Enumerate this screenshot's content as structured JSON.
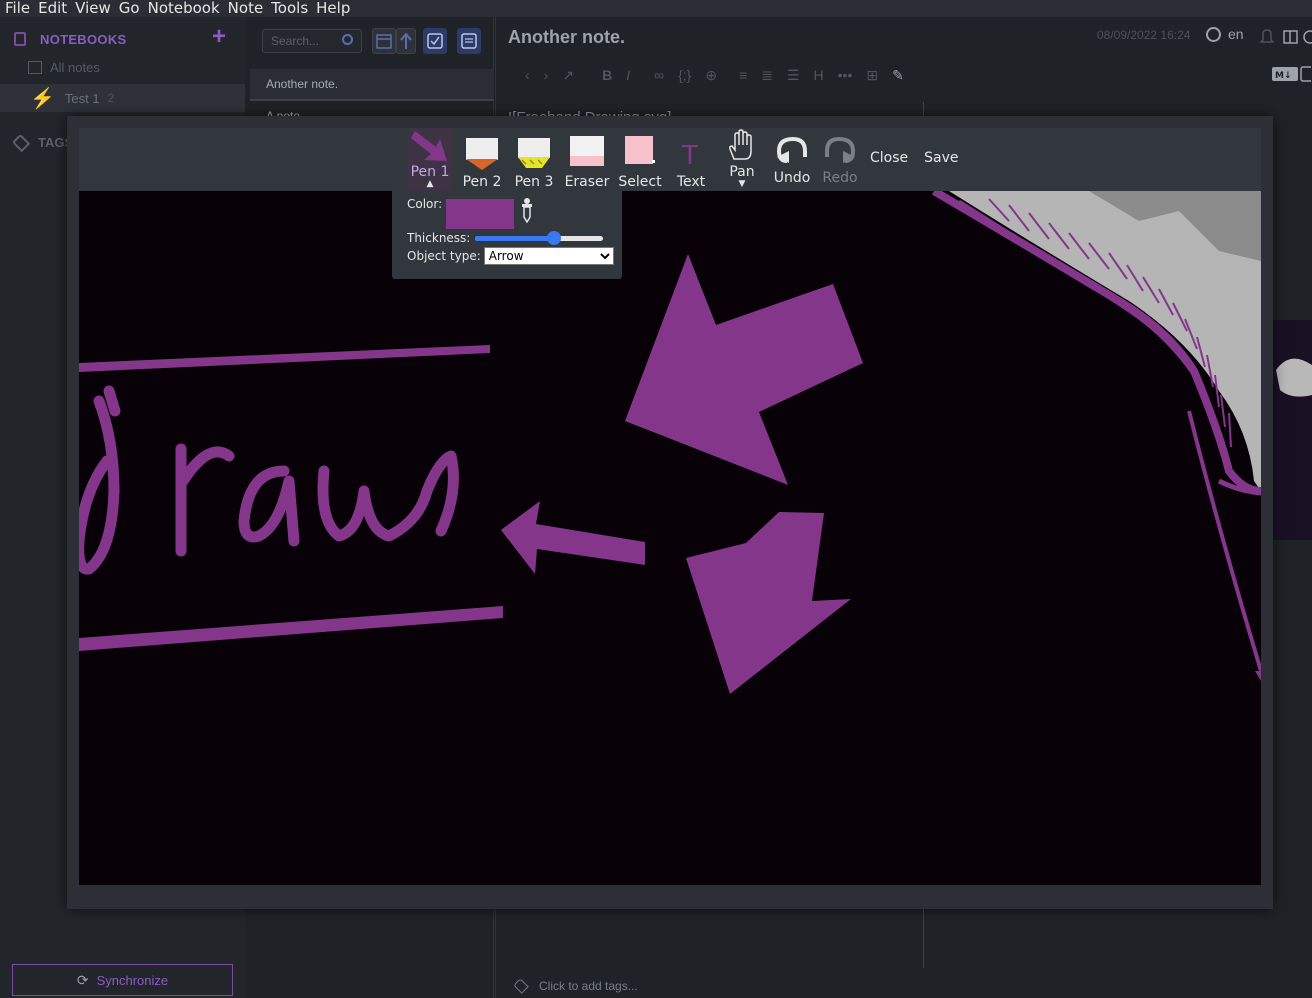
{
  "menu": [
    "File",
    "Edit",
    "View",
    "Go",
    "Notebook",
    "Note",
    "Tools",
    "Help"
  ],
  "sidebar": {
    "notebooks_label": "NOTEBOOKS",
    "all_notes": "All notes",
    "notebooks": [
      {
        "name": "Test 1",
        "count": "2"
      }
    ],
    "tags_label": "TAGS",
    "sync_label": "Synchronize"
  },
  "note_list": {
    "search_placeholder": "Search...",
    "notes": [
      "Another note.",
      "A note"
    ]
  },
  "editor": {
    "title": "Another note.",
    "date": "08/09/2022 16:24",
    "language": "en",
    "body_peek": "![Freehand Drawing.svg]",
    "add_tags": "Click to add tags..."
  },
  "drawing_dialog": {
    "tools": [
      {
        "label": "Pen 1",
        "icon": "arrow-pen-icon",
        "selected": true
      },
      {
        "label": "Pen 2",
        "icon": "orange-pen-icon"
      },
      {
        "label": "Pen 3",
        "icon": "highlighter-icon"
      },
      {
        "label": "Eraser",
        "icon": "eraser-icon"
      },
      {
        "label": "Select",
        "icon": "select-icon"
      },
      {
        "label": "Text",
        "icon": "text-icon"
      },
      {
        "label": "Pan",
        "icon": "hand-icon"
      },
      {
        "label": "Undo",
        "icon": "undo-icon"
      },
      {
        "label": "Redo",
        "icon": "redo-icon",
        "disabled": true
      }
    ],
    "close_label": "Close",
    "save_label": "Save",
    "pen_options": {
      "color_label": "Color:",
      "color": "#84378a",
      "thickness_label": "Thickness:",
      "thickness": 0.62,
      "object_type_label": "Object type:",
      "object_type": "Arrow",
      "object_type_options": [
        "Arrow"
      ]
    },
    "canvas": {
      "background": "#080108",
      "ink_color": "#84378a",
      "handwritten_text": "draw"
    }
  }
}
